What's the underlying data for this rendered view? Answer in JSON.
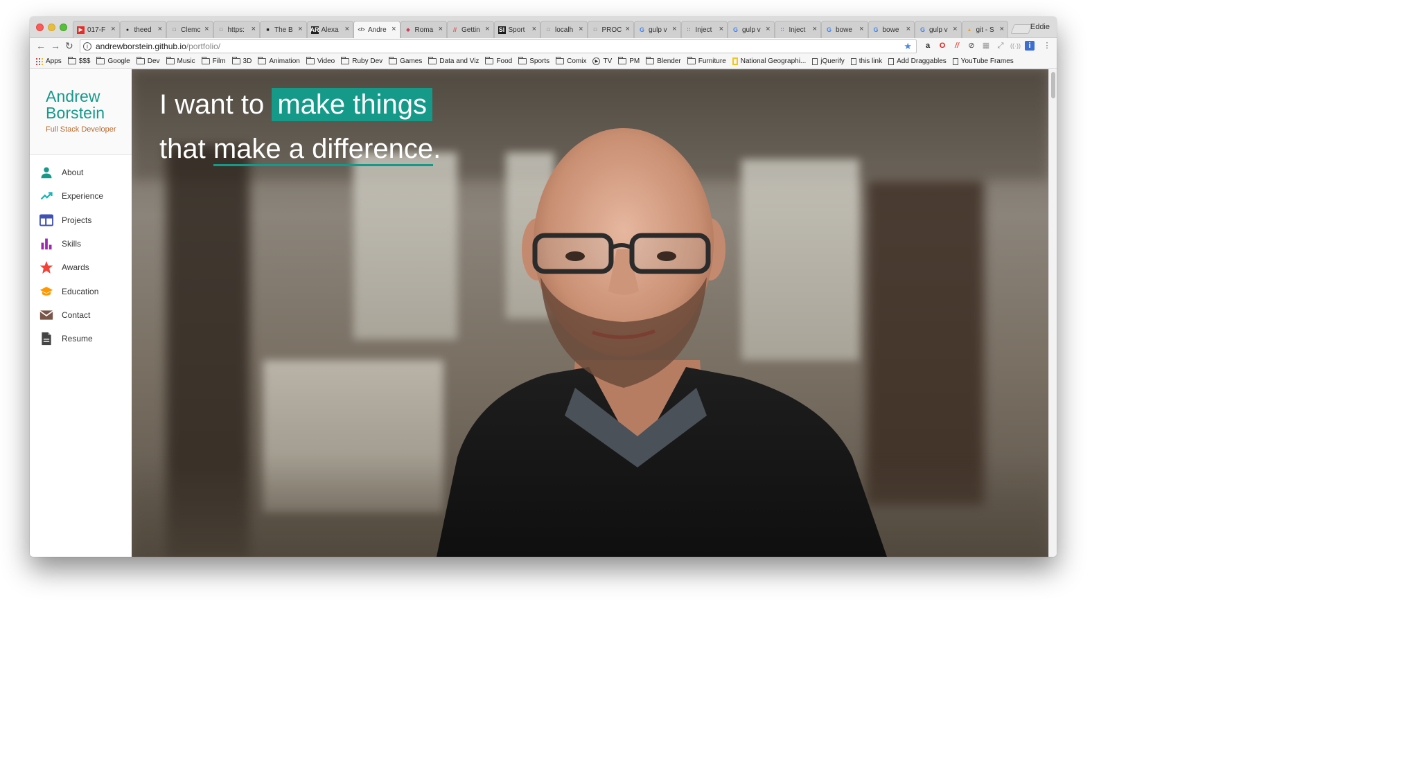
{
  "browser": {
    "tabs": [
      {
        "title": "017-F",
        "icon": "youtube-icon",
        "active": false
      },
      {
        "title": "theed",
        "icon": "github-icon",
        "active": false
      },
      {
        "title": "Clemc",
        "icon": "page-icon",
        "active": false
      },
      {
        "title": "https:",
        "icon": "page-icon",
        "active": false
      },
      {
        "title": "The B",
        "icon": "dark-square-icon",
        "active": false
      },
      {
        "title": "Alexa",
        "icon": "ar-icon",
        "active": false
      },
      {
        "title": "Andre",
        "icon": "code-icon",
        "active": true
      },
      {
        "title": "Roma",
        "icon": "gem-icon",
        "active": false
      },
      {
        "title": "Gettin",
        "icon": "slash-icon",
        "active": false
      },
      {
        "title": "Sport",
        "icon": "si-icon",
        "active": false
      },
      {
        "title": "localh",
        "icon": "page-icon",
        "active": false
      },
      {
        "title": "PROC",
        "icon": "page-icon",
        "active": false
      },
      {
        "title": "gulp v",
        "icon": "google-icon",
        "active": false
      },
      {
        "title": "Inject",
        "icon": "dots-icon",
        "active": false
      },
      {
        "title": "gulp v",
        "icon": "google-icon",
        "active": false
      },
      {
        "title": "Inject",
        "icon": "dots-icon",
        "active": false
      },
      {
        "title": "bowe",
        "icon": "google-icon",
        "active": false
      },
      {
        "title": "bowe",
        "icon": "google-icon",
        "active": false
      },
      {
        "title": "gulp v",
        "icon": "google-icon",
        "active": false
      },
      {
        "title": "git - S",
        "icon": "flame-icon",
        "active": false
      }
    ],
    "close_glyph": "×",
    "profile_name": "Eddie",
    "url_host": "andrewborstein.github.io",
    "url_path": "/portfolio/",
    "info_glyph": "i",
    "bookmarks": [
      {
        "label": "Apps",
        "type": "apps"
      },
      {
        "label": "$$$",
        "type": "folder"
      },
      {
        "label": "Google",
        "type": "folder"
      },
      {
        "label": "Dev",
        "type": "folder"
      },
      {
        "label": "Music",
        "type": "folder"
      },
      {
        "label": "Film",
        "type": "folder"
      },
      {
        "label": "3D",
        "type": "folder"
      },
      {
        "label": "Animation",
        "type": "folder"
      },
      {
        "label": "Video",
        "type": "folder"
      },
      {
        "label": "Ruby Dev",
        "type": "folder"
      },
      {
        "label": "Games",
        "type": "folder"
      },
      {
        "label": "Data and Viz",
        "type": "folder"
      },
      {
        "label": "Food",
        "type": "folder"
      },
      {
        "label": "Sports",
        "type": "folder"
      },
      {
        "label": "Comix",
        "type": "folder"
      },
      {
        "label": "TV",
        "type": "play"
      },
      {
        "label": "PM",
        "type": "folder"
      },
      {
        "label": "Blender",
        "type": "folder"
      },
      {
        "label": "Furniture",
        "type": "folder"
      },
      {
        "label": "National Geographi...",
        "type": "natgeo"
      },
      {
        "label": "jQuerify",
        "type": "page"
      },
      {
        "label": "this link",
        "type": "page"
      },
      {
        "label": "Add Draggables",
        "type": "page"
      },
      {
        "label": "YouTube Frames",
        "type": "page"
      }
    ]
  },
  "site": {
    "brand_first": "Andrew",
    "brand_last": "Borstein",
    "brand_role": "Full Stack Developer",
    "brand_color": "#16998a",
    "role_color": "#b56a2e",
    "nav": [
      {
        "label": "About",
        "icon": "person-icon",
        "color": "#16998a"
      },
      {
        "label": "Experience",
        "icon": "trending-up-icon",
        "color": "#16b3b8"
      },
      {
        "label": "Projects",
        "icon": "web-window-icon",
        "color": "#3f51b5"
      },
      {
        "label": "Skills",
        "icon": "bar-chart-icon",
        "color": "#9c27b0"
      },
      {
        "label": "Awards",
        "icon": "star-icon",
        "color": "#f44336"
      },
      {
        "label": "Education",
        "icon": "graduation-cap-icon",
        "color": "#ff9800"
      },
      {
        "label": "Contact",
        "icon": "envelope-icon",
        "color": "#795548"
      },
      {
        "label": "Resume",
        "icon": "document-icon",
        "color": "#444444"
      }
    ],
    "headline": {
      "line1_pre": "I want to ",
      "line1_highlight": "make things",
      "line2_pre": "that ",
      "line2_underlined": "make a difference",
      "line2_post": ".",
      "accent_color": "#159a8a"
    }
  }
}
